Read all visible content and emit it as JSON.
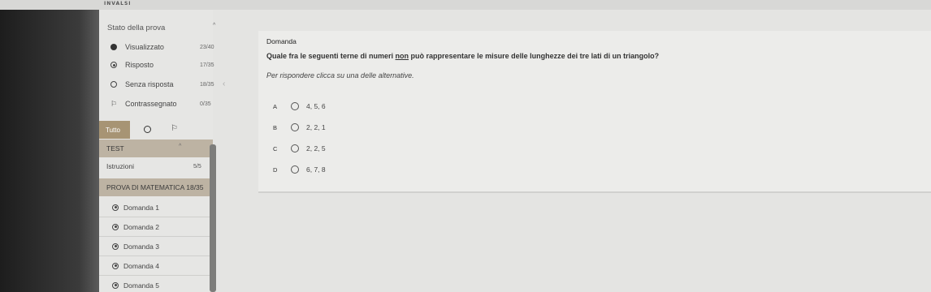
{
  "app": {
    "logo": "INVALSI"
  },
  "sidebar": {
    "status_title": "Stato della prova",
    "status_items": [
      {
        "label": "Visualizzato",
        "count": "23/40",
        "icon": "filled-radio-icon"
      },
      {
        "label": "Risposto",
        "count": "17/35",
        "icon": "dotted-radio-icon"
      },
      {
        "label": "Senza risposta",
        "count": "18/35",
        "icon": "empty-radio-icon"
      },
      {
        "label": "Contrassegnato",
        "count": "0/35",
        "icon": "flag-icon"
      }
    ],
    "filter": {
      "all_label": "Tutto"
    },
    "test_label": "TEST",
    "instructions": {
      "label": "Istruzioni",
      "count": "5/5"
    },
    "section_label": "PROVA DI MATEMATICA 18/35",
    "questions": [
      "Domanda 1",
      "Domanda 2",
      "Domanda 3",
      "Domanda 4",
      "Domanda 5"
    ]
  },
  "question": {
    "header": "Domanda",
    "text_before": "Quale fra le seguenti terne di numeri ",
    "text_underlined": "non",
    "text_after": " può rappresentare le misure delle lunghezze dei tre lati di un triangolo?",
    "instructions": "Per rispondere clicca su una delle alternative.",
    "options": [
      {
        "letter": "A",
        "text": "4, 5, 6"
      },
      {
        "letter": "B",
        "text": "2, 2, 1"
      },
      {
        "letter": "C",
        "text": "2, 2, 5"
      },
      {
        "letter": "D",
        "text": "6, 7, 8"
      }
    ]
  },
  "colors": {
    "accent": "#a79474",
    "section_bg": "#bdb3a3",
    "panel_bg": "#ececea"
  }
}
